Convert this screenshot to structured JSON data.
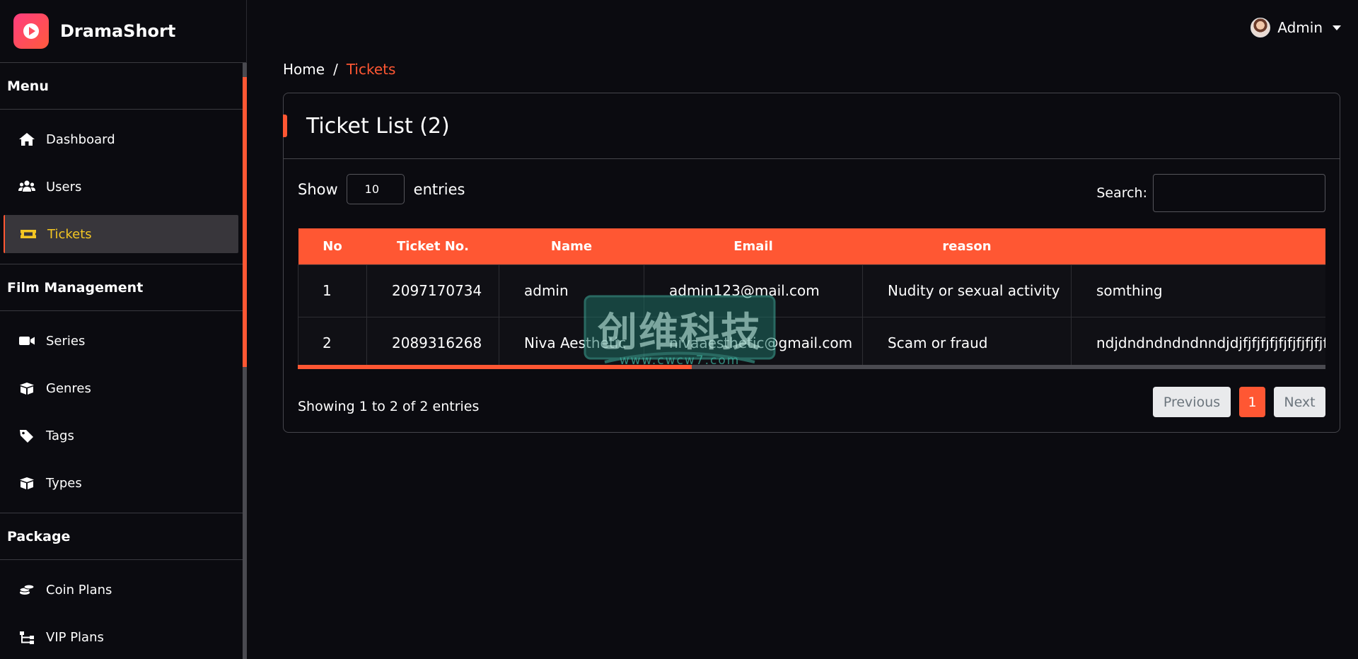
{
  "brand": {
    "name": "DramaShort"
  },
  "sidebar": {
    "sections": [
      {
        "title": "Menu",
        "items": [
          {
            "label": "Dashboard",
            "icon": "home-icon",
            "active": false
          },
          {
            "label": "Users",
            "icon": "users-icon",
            "active": false
          },
          {
            "label": "Tickets",
            "icon": "ticket-icon",
            "active": true
          }
        ]
      },
      {
        "title": "Film Management",
        "items": [
          {
            "label": "Series",
            "icon": "video-icon",
            "active": false
          },
          {
            "label": "Genres",
            "icon": "box-icon",
            "active": false
          },
          {
            "label": "Tags",
            "icon": "tag-icon",
            "active": false
          },
          {
            "label": "Types",
            "icon": "box-icon",
            "active": false
          }
        ]
      },
      {
        "title": "Package",
        "items": [
          {
            "label": "Coin Plans",
            "icon": "coins-icon",
            "active": false
          },
          {
            "label": "VIP Plans",
            "icon": "sitemap-icon",
            "active": false
          }
        ]
      }
    ]
  },
  "header": {
    "user_name": "Admin"
  },
  "breadcrumb": {
    "home": "Home",
    "separator": "/",
    "current": "Tickets"
  },
  "card": {
    "title": "Ticket List (2)",
    "show_label": "Show",
    "entries_label": "entries",
    "page_length": "10",
    "search_label": "Search:",
    "search_value": ""
  },
  "table": {
    "columns": [
      "No",
      "Ticket No.",
      "Name",
      "Email",
      "reason",
      ""
    ],
    "rows": [
      [
        "1",
        "2097170734",
        "admin",
        "admin123@mail.com",
        "Nudity or sexual activity",
        "somthing"
      ],
      [
        "2",
        "2089316268",
        "Niva Aesthetic",
        "nivaaesthetic@gmail.com",
        "Scam or fraud",
        "ndjdndndndndnndjdjfjfjfjfjfjfjfjfjfjfjfjfjfjf"
      ]
    ]
  },
  "footer": {
    "info": "Showing 1 to 2 of 2 entries",
    "prev_label": "Previous",
    "page": "1",
    "next_label": "Next"
  },
  "watermark": {
    "title": "创维科技",
    "url": "www.cwcw7.com"
  },
  "colors": {
    "accent": "#ff5733",
    "active_text": "#f3c623",
    "background": "#0b0b10"
  }
}
